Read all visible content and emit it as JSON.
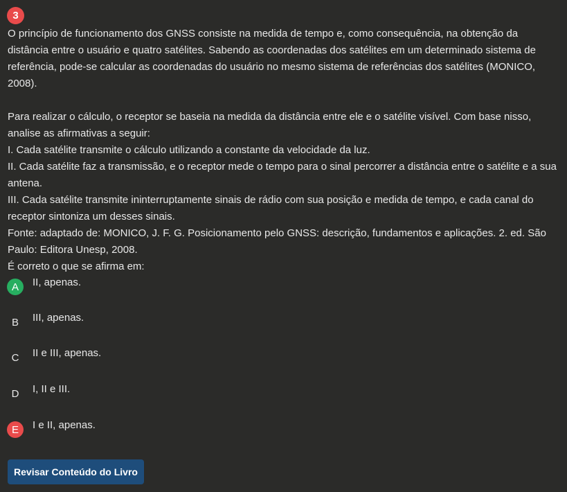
{
  "question": {
    "number": "3",
    "paragraph1": "O princípio de funcionamento dos GNSS consiste na medida de tempo e, como consequência, na obtenção da distância entre o usuário e quatro satélites. Sabendo as coordenadas dos satélites em um determinado sistema de referência, pode-se calcular as coordenadas do usuário no mesmo sistema de referências dos satélites (MONICO, 2008).",
    "paragraph2": "Para realizar o cálculo, o receptor se baseia na medida da distância entre ele e o satélite visível. Com base nisso, analise as afirmativas a seguir:",
    "statement1": "I. Cada satélite transmite o cálculo utilizando a constante da velocidade da luz.",
    "statement2": "II. Cada satélite faz a transmissão, e o receptor mede o tempo para o sinal percorrer a distância entre o satélite e a sua antena.",
    "statement3": "III. Cada satélite transmite ininterruptamente sinais de rádio com sua posição e medida de tempo, e cada canal do receptor sintoniza um desses sinais.",
    "source": "Fonte: adaptado de: MONICO, J. F. G. Posicionamento pelo GNSS: descrição, fundamentos e aplicações. 2. ed. São Paulo: Editora Unesp, 2008.",
    "prompt": "É correto o que se afirma em:"
  },
  "options": [
    {
      "letter": "A",
      "text": "II, apenas.",
      "status": "correct"
    },
    {
      "letter": "B",
      "text": "III, apenas.",
      "status": "none"
    },
    {
      "letter": "C",
      "text": "II e III, apenas.",
      "status": "none"
    },
    {
      "letter": "D",
      "text": "I, II e III.",
      "status": "none"
    },
    {
      "letter": "E",
      "text": "I e II, apenas.",
      "status": "wrong"
    }
  ],
  "review_button": {
    "label": "Revisar Conteúdo do Livro"
  },
  "colors": {
    "background": "#2b2b29",
    "correct": "#27ae60",
    "wrong": "#e94b4b",
    "button": "#1e4d7b"
  }
}
